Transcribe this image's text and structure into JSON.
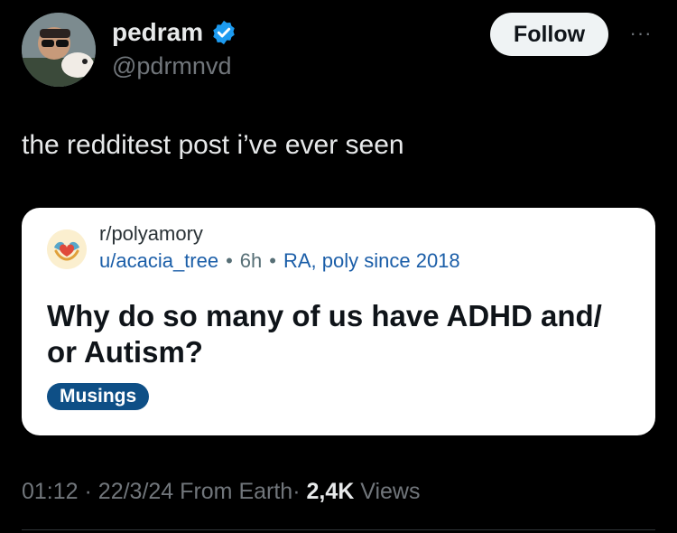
{
  "author": {
    "display_name": "pedram",
    "handle": "@pdrmnvd",
    "verified": true
  },
  "actions": {
    "follow_label": "Follow",
    "more_label": "···"
  },
  "tweet": {
    "text": "the redditest post i’ve ever seen"
  },
  "reddit_card": {
    "subreddit": "r/polyamory",
    "username": "u/acacia_tree",
    "age": "6h",
    "user_flair": "RA, poly since 2018",
    "title": "Why do so many of us have ADHD and/ or Autism?",
    "post_flair": "Musings",
    "flair_color": "#0e4f86"
  },
  "footer": {
    "time": "01:12",
    "date": "22/3/24",
    "source": "From Earth",
    "views_count": "2,4K",
    "views_label": "Views",
    "separator": "·"
  },
  "colors": {
    "background": "#000000",
    "verified_blue": "#1d9bf0",
    "link_blue": "#1b5ea8"
  }
}
